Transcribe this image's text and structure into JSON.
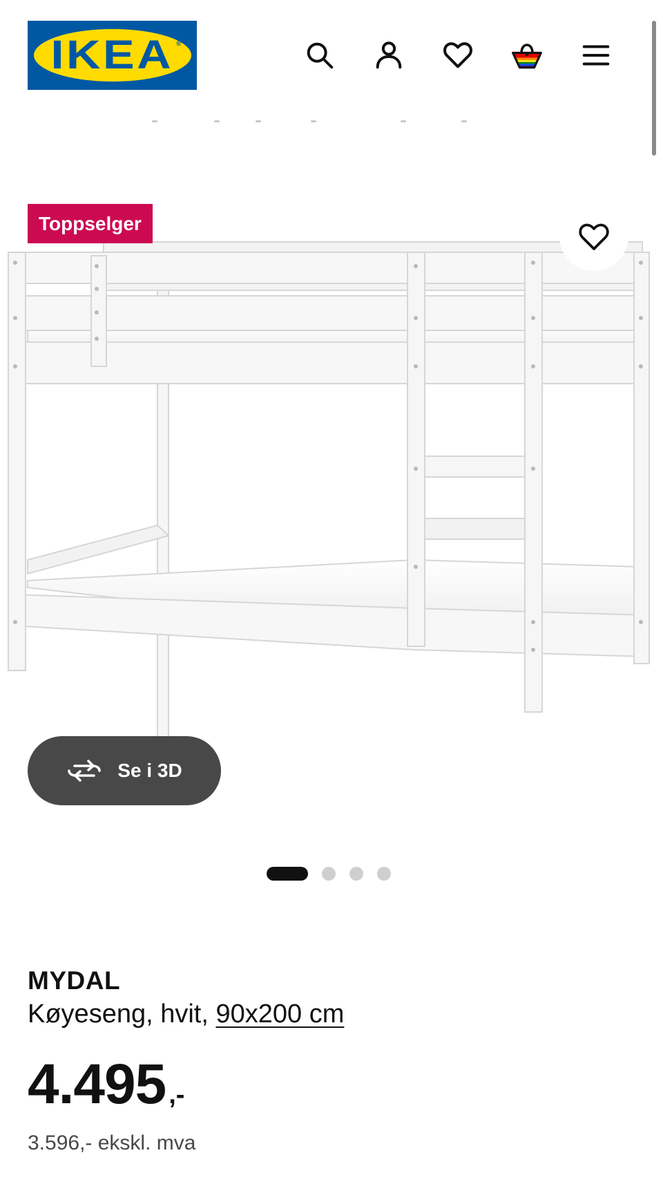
{
  "header": {
    "logo_text": "IKEA",
    "logo_reg": "®",
    "icons": [
      "search-icon",
      "user-icon",
      "heart-icon",
      "basket-icon",
      "menu-icon"
    ]
  },
  "product": {
    "badge": "Toppselger",
    "view_3d_label": "Se i 3D",
    "carousel": {
      "count": 4,
      "active_index": 0
    },
    "name": "MYDAL",
    "description_prefix": "Køyeseng, hvit, ",
    "size_link": "90x200 cm",
    "price": "4.495",
    "price_suffix": ",-",
    "price_ex_vat": "3.596,- ekskl. mva"
  },
  "colors": {
    "ikea_blue": "#0058a3",
    "ikea_yellow": "#ffdb00",
    "badge_red": "#cc0a52",
    "button_dark": "#484848",
    "text": "#111111"
  }
}
